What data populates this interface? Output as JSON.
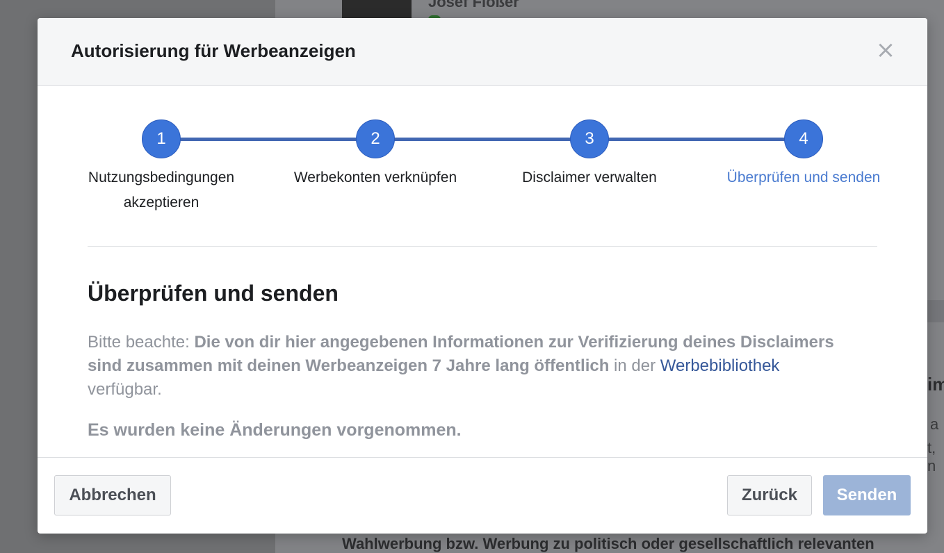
{
  "background": {
    "profile_name": "Josef Floßer",
    "fragment_1": "im",
    "fragment_2": "a",
    "fragment_3": "t, n",
    "bottom_text": "Wahlwerbung bzw. Werbung zu politisch oder gesellschaftlich relevanten"
  },
  "modal": {
    "title": "Autorisierung für Werbeanzeigen",
    "close_glyph": "×",
    "steps": [
      {
        "number": "1",
        "label": "Nutzungsbedingungen akzeptieren"
      },
      {
        "number": "2",
        "label": "Werbekonten verknüpfen"
      },
      {
        "number": "3",
        "label": "Disclaimer verwalten"
      },
      {
        "number": "4",
        "label": "Überprüfen und senden"
      }
    ],
    "active_step": 4,
    "section_title": "Überprüfen und senden",
    "notice": {
      "prefix": "Bitte beachte: ",
      "bold": "Die von dir hier angegebenen Informationen zur Verifizierung deines Disclaimers sind zusammen mit deinen Werbeanzeigen 7 Jahre lang öffentlich",
      "middle": " in der ",
      "link": "Werbebibliothek",
      "suffix": " verfügbar."
    },
    "status": "Es wurden keine Änderungen vorgenommen.",
    "buttons": {
      "cancel": "Abbrechen",
      "back": "Zurück",
      "send": "Senden"
    }
  },
  "colors": {
    "accent": "#3b74d9",
    "active_label": "#4a7bd0",
    "link": "#365899",
    "send_disabled": "#9cb4d8"
  }
}
